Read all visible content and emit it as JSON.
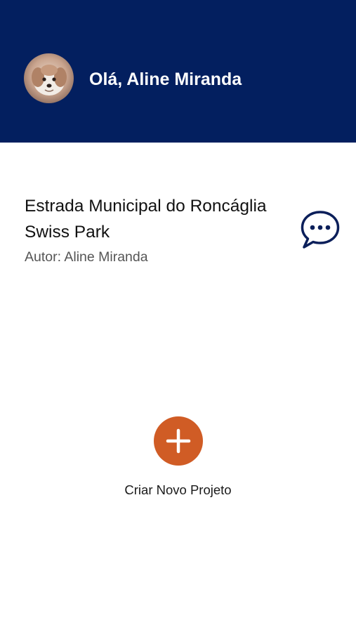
{
  "header": {
    "greeting": "Olá, Aline Miranda",
    "background_color": "#031f5f",
    "avatar_icon": "user-avatar-photo"
  },
  "project": {
    "title": "Estrada Municipal do Roncáglia Swiss Park",
    "author": "Autor: Aline Miranda",
    "comment_icon": "chat-bubble-dots-icon"
  },
  "new_project": {
    "label": "Criar Novo Projeto",
    "icon": "plus-icon",
    "button_color": "#d05c25"
  }
}
